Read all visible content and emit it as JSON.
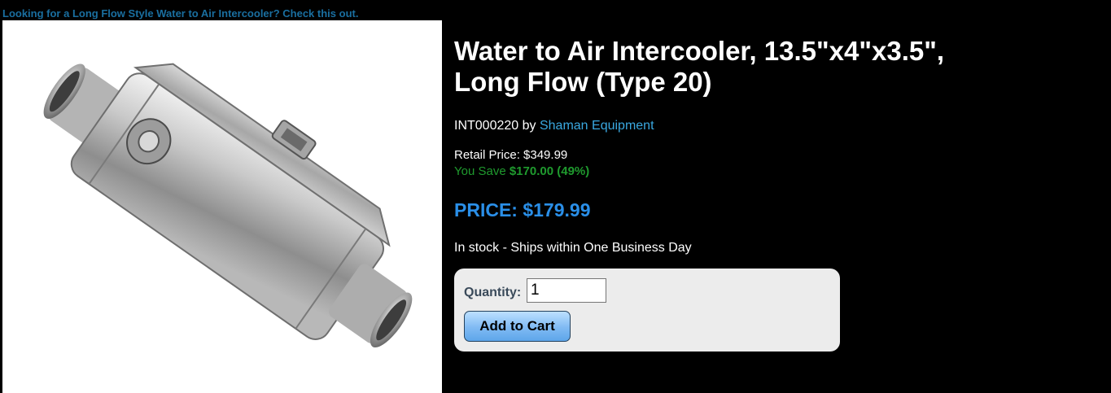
{
  "promo": {
    "text": "Looking for a Long Flow Style Water to Air Intercooler? Check this out."
  },
  "product": {
    "image_alt": "Water to Air Intercooler",
    "title_line1": "Water to Air Intercooler, 13.5\"x4\"x3.5\",",
    "title_line2": "Long Flow (Type 20)",
    "sku": "INT000220",
    "by": "by",
    "brand": "Shaman Equipment",
    "retail_label": "Retail Price:",
    "retail_value": "$349.99",
    "save_label": "You Save",
    "save_value": "$170.00 (49%)",
    "price_label": "PRICE:",
    "price_value": "$179.99",
    "stock": "In stock - Ships within One Business Day"
  },
  "cart": {
    "quantity_label": "Quantity:",
    "quantity_value": "1",
    "add_button": "Add to Cart"
  },
  "colors": {
    "background": "#000000",
    "link": "#3aa8e0",
    "promo_link": "#1a6fa0",
    "price": "#2a8fe8",
    "savings": "#1f9a2e",
    "cart_box": "#ececec"
  }
}
